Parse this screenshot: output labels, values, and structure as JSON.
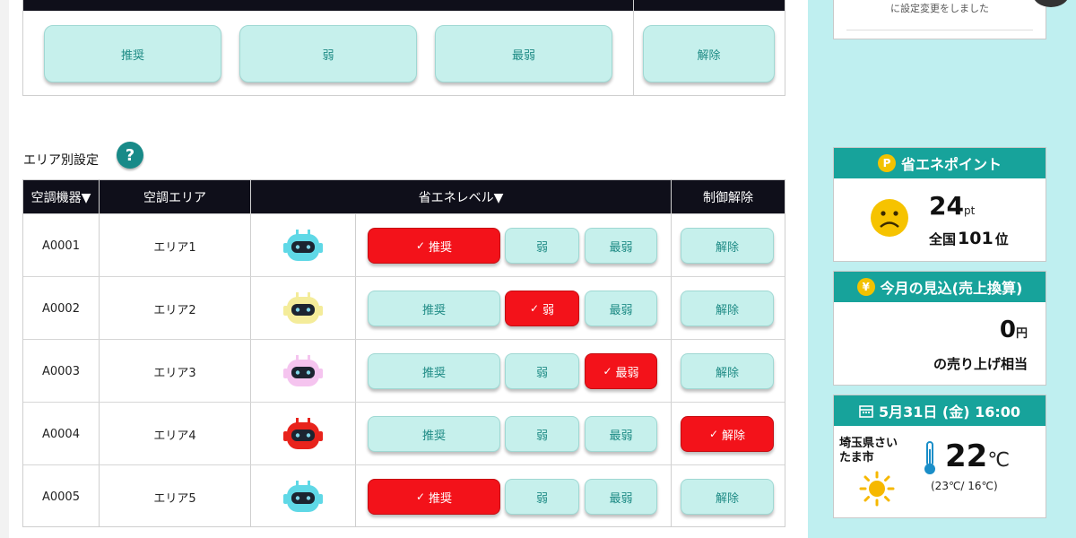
{
  "top_panel": {
    "levels": [
      {
        "label": "推奨"
      },
      {
        "label": "弱"
      },
      {
        "label": "最弱"
      }
    ],
    "release_label": "解除"
  },
  "notice_card": {
    "message": "に設定変更をしました"
  },
  "section": {
    "title": "エリア別設定",
    "help_icon": "?"
  },
  "table": {
    "headers": {
      "device": "空調機器▼",
      "area": "空調エリア",
      "level": "省エネレベル▼",
      "release": "制御解除"
    },
    "button_labels": {
      "recommended": "推奨",
      "weak": "弱",
      "weakest": "最弱",
      "release": "解除",
      "check": "✓"
    },
    "rows": [
      {
        "device": "A0001",
        "area": "エリア1",
        "robot_color": "#5fd8e6",
        "active": "recommended"
      },
      {
        "device": "A0002",
        "area": "エリア2",
        "robot_color": "#f4ec9a",
        "active": "weak"
      },
      {
        "device": "A0003",
        "area": "エリア3",
        "robot_color": "#f5c4ef",
        "active": "weakest"
      },
      {
        "device": "A0004",
        "area": "エリア4",
        "robot_color": "#e8231c",
        "active": "release"
      },
      {
        "device": "A0005",
        "area": "エリア5",
        "robot_color": "#5fd8e6",
        "active": "recommended"
      }
    ]
  },
  "points_card": {
    "title": "省エネポイント",
    "coin_symbol": "P",
    "points": "24",
    "points_unit": "pt",
    "rank_prefix": "全国",
    "rank": "101",
    "rank_suffix": "位"
  },
  "estimate_card": {
    "title": "今月の見込(売上換算)",
    "coin_symbol": "¥",
    "amount": "0",
    "amount_unit": "円",
    "description": "の売り上げ相当"
  },
  "weather_card": {
    "title": "5月31日 (金) 16:00",
    "location": "埼玉県さいたま市",
    "temperature": "22",
    "temperature_unit": "℃",
    "range": "(23℃/ 16℃)"
  },
  "colors": {
    "accent_teal": "#17a39b",
    "button_mint": "#c6f0ec",
    "active_red": "#f3121a",
    "header_dark": "#0f0f1a",
    "sidebar_bg": "#bfeff0"
  }
}
